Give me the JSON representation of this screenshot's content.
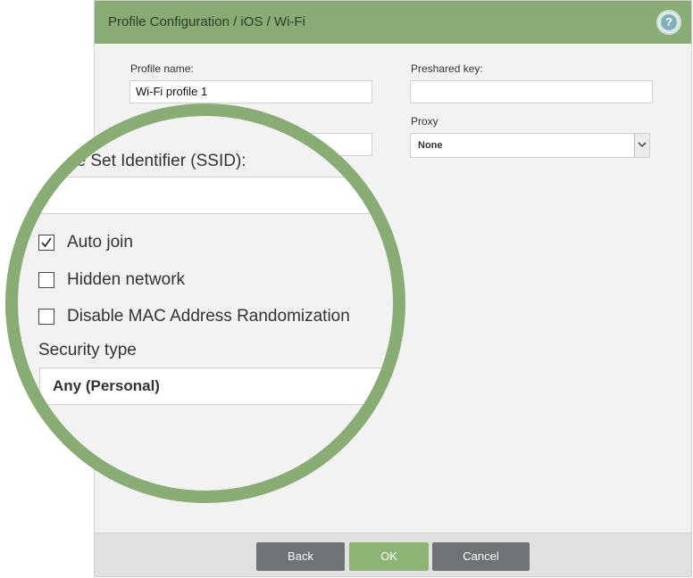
{
  "dialog": {
    "title": "Profile Configuration / iOS / Wi-Fi",
    "help_glyph": "?"
  },
  "form": {
    "profile_name_label": "Profile name:",
    "profile_name_value": "Wi-Fi profile 1",
    "preshared_key_label": "Preshared key:",
    "preshared_key_value": "",
    "proxy_label": "Proxy",
    "proxy_value": "None",
    "ssid_label": "ce Set Identifier (SSID):",
    "ssid_value": "",
    "auto_join_label": "Auto join",
    "auto_join_checked": true,
    "hidden_network_label": "Hidden network",
    "hidden_network_checked": false,
    "disable_mac_label": "Disable MAC Address Randomization",
    "disable_mac_checked": false,
    "security_type_label": "Security type",
    "security_type_value": "Any (Personal)"
  },
  "footer": {
    "back_label": "Back",
    "ok_label": "OK",
    "cancel_label": "Cancel"
  },
  "colors": {
    "accent": "#88ac73",
    "button_dark": "#6d7377",
    "button_ok": "#8db474",
    "panel_bg": "#f2f2f2"
  },
  "icons": {
    "help": "help-circle-icon",
    "dropdown": "chevron-down-icon",
    "check": "checkmark-icon"
  }
}
